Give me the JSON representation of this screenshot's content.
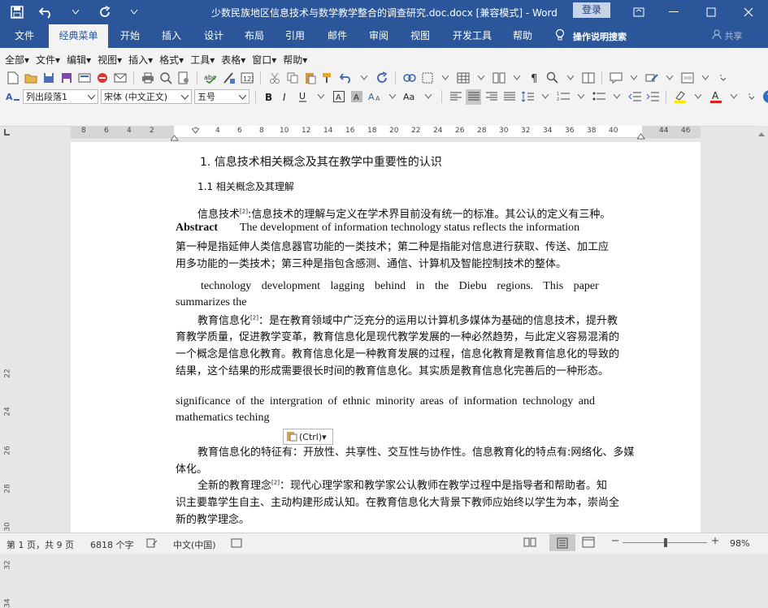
{
  "window": {
    "title": "少数民族地区信息技术与数学教学整合的调查研究.doc.docx [兼容模式] - Word",
    "login_label": "登录"
  },
  "tabs": [
    {
      "label": "文件"
    },
    {
      "label": "经典菜单"
    },
    {
      "label": "开始"
    },
    {
      "label": "插入"
    },
    {
      "label": "设计"
    },
    {
      "label": "布局"
    },
    {
      "label": "引用"
    },
    {
      "label": "邮件"
    },
    {
      "label": "审阅"
    },
    {
      "label": "视图"
    },
    {
      "label": "开发工具"
    },
    {
      "label": "帮助"
    }
  ],
  "tell_me": "操作说明搜索",
  "share_label": "共享",
  "menus": [
    "全部▾",
    "文件▾",
    "编辑▾",
    "视图▾",
    "插入▾",
    "格式▾",
    "工具▾",
    "表格▾",
    "窗口▾",
    "帮助▾"
  ],
  "format_bar": {
    "style": "列出段落1",
    "font": "宋体 (中文正文)",
    "size": "五号"
  },
  "ruler_numbers": [
    "8",
    "6",
    "4",
    "2",
    "2",
    "4",
    "6",
    "8",
    "10",
    "12",
    "14",
    "16",
    "18",
    "20",
    "22",
    "24",
    "26",
    "28",
    "30",
    "32",
    "34",
    "36",
    "38",
    "40",
    "44",
    "46"
  ],
  "vruler_numbers": [
    "22",
    "24",
    "26",
    "28",
    "30",
    "32",
    "34"
  ],
  "document": {
    "heading1": "1.  信息技术相关概念及其在教学中重要性的认识",
    "heading2": "1.1 相关概念及其理解",
    "p1_start": "信息技术",
    "ref": "[2]",
    "p1_end": ":信息技术的理解与定义在学术界目前没有统一的标准。其公认的定义有三种。",
    "abstract_label": "Abstract",
    "abstract_text": "The development of information technology status reflects the information",
    "p2_line1": "第一种是指延伸人类信息器官功能的一类技术；第二种是指能对信息进行获取、传送、加工应",
    "p2_line2": "用多功能的一类技术；第三种是指包含感测、通信、计算机及智能控制技术的整体。",
    "en2_line1": "technology development lagging behind in the Diebu regions. This paper",
    "en2_line2": "summarizes the",
    "p3_start": "教育信息化",
    "p3_line1_end": "：是在教育领域中广泛充分的运用以计算机多媒体为基础的信息技术，提升教",
    "p3_line2": "育教学质量，促进教学变革，教育信息化是现代教学发展的一种必然趋势，与此定义容易混淆的",
    "p3_line3": "一个概念是信息化教育。教育信息化是一种教育发展的过程，信息化教育是教育信息化的导致的",
    "p3_line4": "结果，这个结果的形成需要很长时间的教育信息化。其实质是教育信息化完善后的一种形态。",
    "en3_line1": "significance of the intergration of ethnic minority areas of information technology and",
    "en3_line2": "mathematics teching",
    "ctrl_label": "(Ctrl)▾",
    "p4_line1": "教育信息化的特征有：开放性、共享性、交互性与协作性。信息教育化的特点有:网络化、多媒",
    "p4_line2": "体化。",
    "p5_start": "全新的教育理念",
    "p5_line1_end": "：现代心理学家和教学家公认教师在教学过程中是指导者和帮助者。知",
    "p5_line2": "识主要靠学生自主、主动构建形成认知。在教育信息化大背景下教师应始终以学生为本，崇尚全",
    "p5_line3": "新的教学理念。"
  },
  "status": {
    "page": "第 1 页，共 9 页",
    "words": "6818 个字",
    "lang": "中文(中国)",
    "zoom": "98%"
  },
  "colors": {
    "brand": "#2b579a"
  }
}
